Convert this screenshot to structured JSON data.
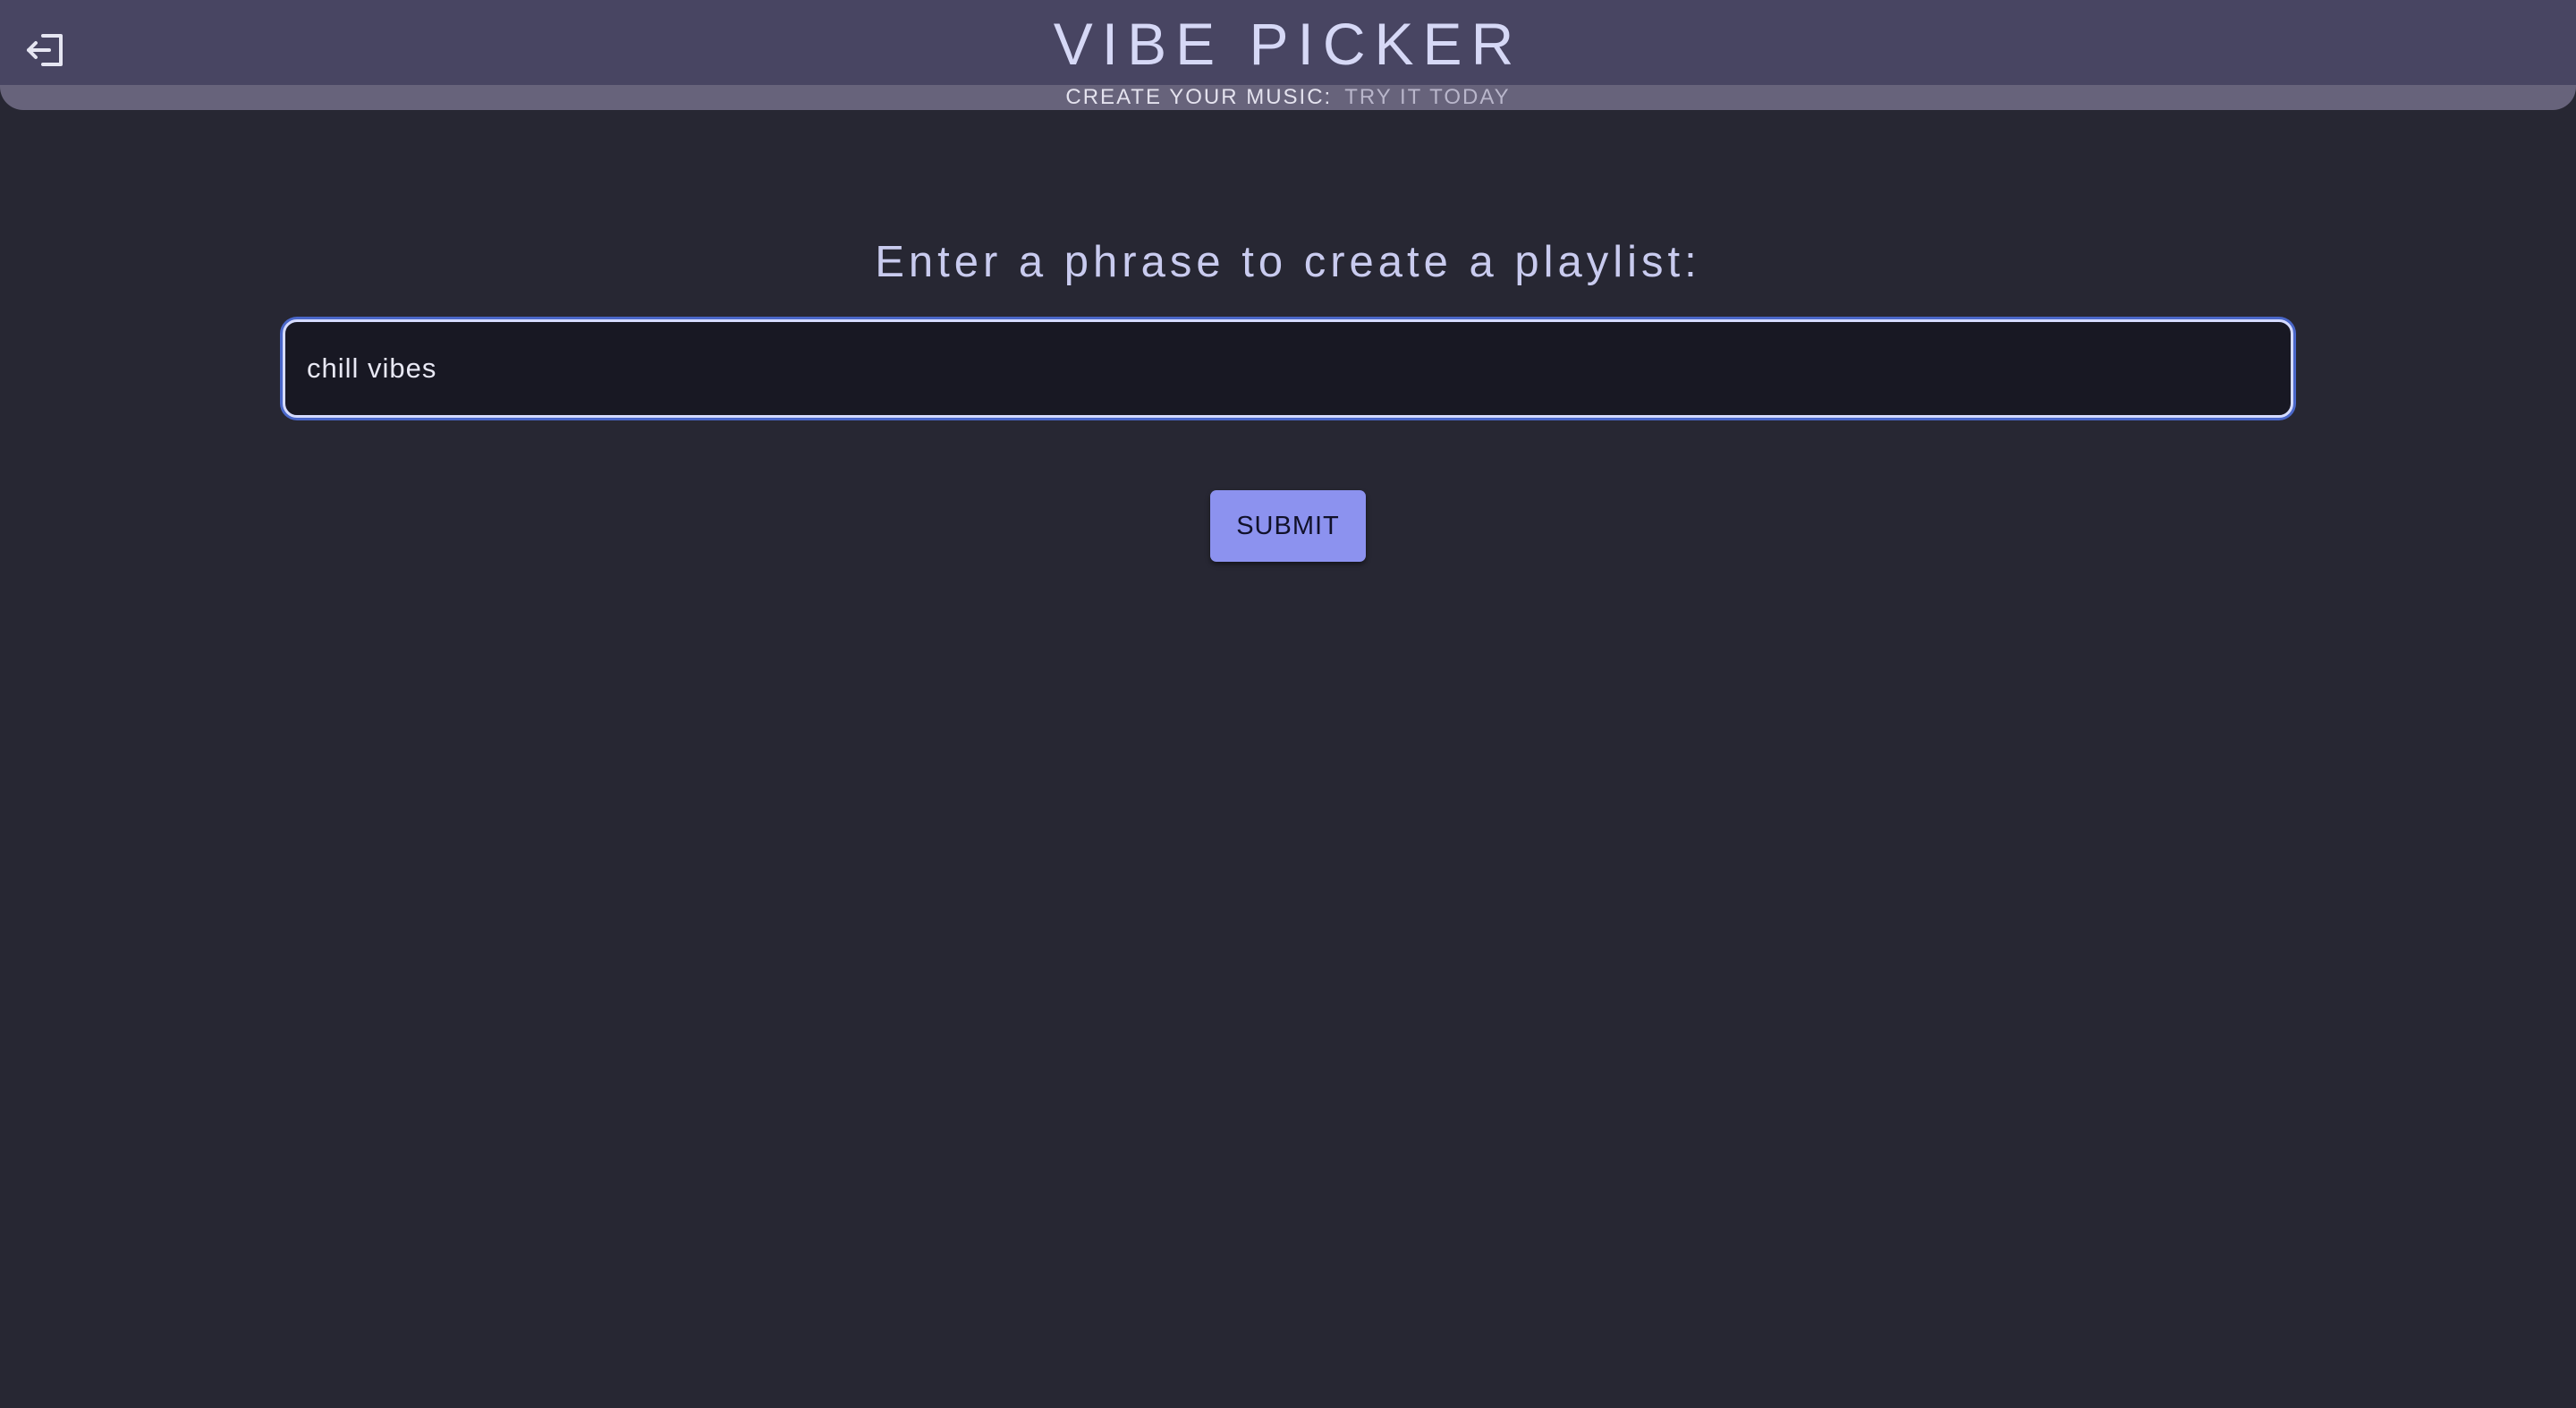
{
  "header": {
    "title": "VIBE PICKER",
    "tagline_lead": "CREATE YOUR MUSIC:",
    "tagline_cta": "TRY IT TODAY",
    "logout_icon": "logout-icon"
  },
  "main": {
    "prompt": "Enter a phrase to create a playlist:",
    "phrase_input": {
      "value": "chill vibes",
      "placeholder": ""
    },
    "submit_label": "SUBMIT"
  },
  "colors": {
    "background": "#272733",
    "header": "#484562",
    "accent": "#8c92ef",
    "input_focus": "#4a67c9",
    "text": "#d6d8f6"
  }
}
